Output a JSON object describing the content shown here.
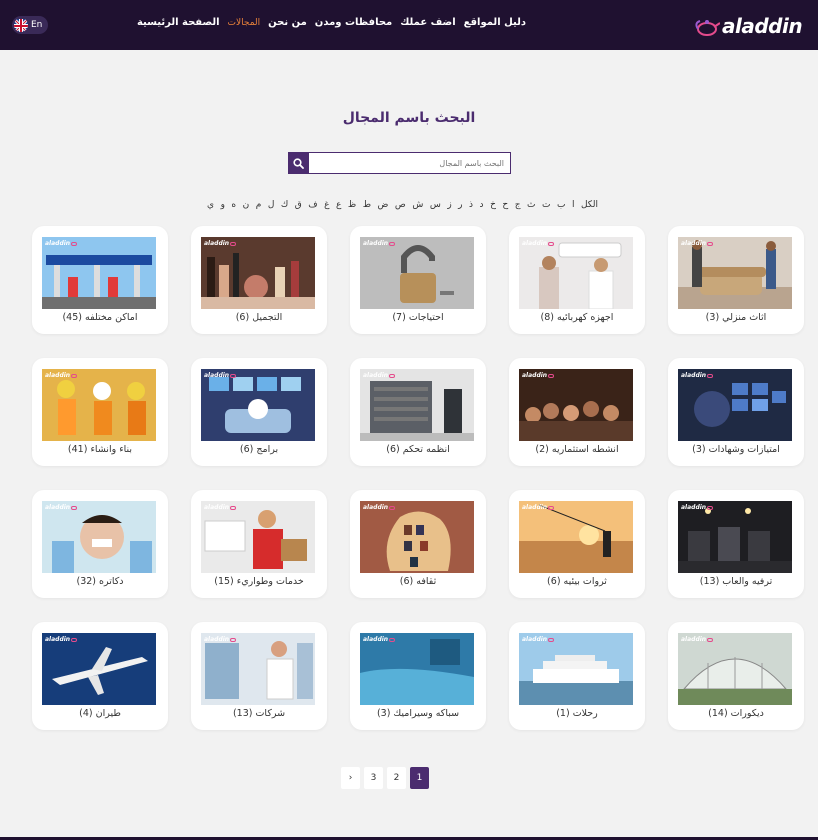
{
  "header": {
    "logo_text": "aladdin",
    "nav": [
      {
        "label": "الصفحة الرئيسية",
        "active": false
      },
      {
        "label": "المجالات",
        "active": true
      },
      {
        "label": "من نحن",
        "active": false
      },
      {
        "label": "محافظات ومدن",
        "active": false
      },
      {
        "label": "اضف عملك",
        "active": false
      },
      {
        "label": "دليل المواقع",
        "active": false
      }
    ],
    "lang_label": "En"
  },
  "main": {
    "title": "البحث باسم المجال",
    "search_placeholder": "البحث باسم المجال",
    "letters": [
      "الكل",
      "ا",
      "ب",
      "ت",
      "ث",
      "ج",
      "ح",
      "خ",
      "د",
      "ذ",
      "ر",
      "ز",
      "س",
      "ش",
      "ص",
      "ض",
      "ط",
      "ظ",
      "ع",
      "غ",
      "ف",
      "ق",
      "ك",
      "ل",
      "م",
      "ن",
      "ه",
      "و",
      "ي"
    ],
    "brand_mark": "aladdin",
    "cards": [
      {
        "label": "اثاث منزلي (3)",
        "scene": "furniture"
      },
      {
        "label": "اجهزه كهربائيه (8)",
        "scene": "ac"
      },
      {
        "label": "احتياجات (7)",
        "scene": "lock"
      },
      {
        "label": "التجميل (6)",
        "scene": "cosmetics"
      },
      {
        "label": "اماكن مختلفه (45)",
        "scene": "station"
      },
      {
        "label": "امتيازات وشهادات (3)",
        "scene": "tech"
      },
      {
        "label": "انشطه استثماريه (2)",
        "scene": "crowd"
      },
      {
        "label": "انظمه تحكم (6)",
        "scene": "garage"
      },
      {
        "label": "برامج (6)",
        "scene": "software"
      },
      {
        "label": "بناء وانشاء (41)",
        "scene": "construction"
      },
      {
        "label": "ترفيه والعاب (13)",
        "scene": "gym"
      },
      {
        "label": "ثروات بيئيه (6)",
        "scene": "fishing"
      },
      {
        "label": "ثقافه (6)",
        "scene": "books"
      },
      {
        "label": "خدمات وطواريء (15)",
        "scene": "delivery"
      },
      {
        "label": "دكاتره (32)",
        "scene": "dentist"
      },
      {
        "label": "ديكورات (14)",
        "scene": "greenhouse"
      },
      {
        "label": "رحلات (1)",
        "scene": "ship"
      },
      {
        "label": "سباكه وسيراميك (3)",
        "scene": "floor"
      },
      {
        "label": "شركات (13)",
        "scene": "warehouse"
      },
      {
        "label": "طيران (4)",
        "scene": "plane"
      }
    ],
    "pagination": [
      {
        "label": "1",
        "active": true
      },
      {
        "label": "2",
        "active": false
      },
      {
        "label": "3",
        "active": false
      },
      {
        "label": "›",
        "active": false
      }
    ]
  },
  "colors": {
    "header_bg": "#1f1130",
    "accent_purple": "#4b2c6f",
    "active_nav": "#e9823a"
  }
}
